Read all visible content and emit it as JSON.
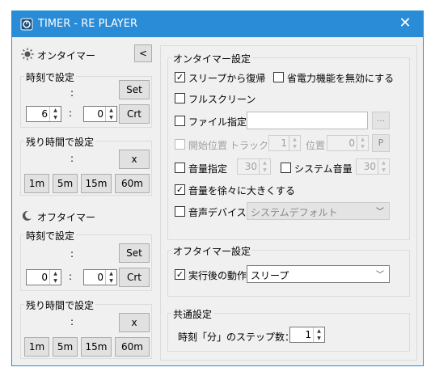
{
  "window": {
    "title": "TIMER - RE PLAYER"
  },
  "left": {
    "on_timer": {
      "label": "オンタイマー",
      "collapse_label": "<",
      "time_group": {
        "title": "時刻で設定",
        "dot": ":",
        "set_label": "Set",
        "hour": "6",
        "colon": ":",
        "minute": "0",
        "crt_label": "Crt"
      },
      "remain_group": {
        "title": "残り時間で設定",
        "dot": ":",
        "x_label": "x",
        "presets": [
          "1m",
          "5m",
          "15m",
          "60m"
        ]
      }
    },
    "off_timer": {
      "label": "オフタイマー",
      "time_group": {
        "title": "時刻で設定",
        "dot": ":",
        "set_label": "Set",
        "hour": "0",
        "colon": ":",
        "minute": "0",
        "crt_label": "Crt"
      },
      "remain_group": {
        "title": "残り時間で設定",
        "dot": ":",
        "x_label": "x",
        "presets": [
          "1m",
          "5m",
          "15m",
          "60m"
        ]
      }
    }
  },
  "right": {
    "on_settings": {
      "title": "オンタイマー設定",
      "resume_from_sleep": {
        "label": "スリープから復帰",
        "checked": true
      },
      "disable_power_saving": {
        "label": "省電力機能を無効にする",
        "checked": false
      },
      "fullscreen": {
        "label": "フルスクリーン",
        "checked": false
      },
      "file_specify": {
        "label": "ファイル指定",
        "checked": false,
        "browse": "…"
      },
      "start_position": {
        "label": "開始位置",
        "track_label": "トラック",
        "track": "1",
        "pos_label": "位置",
        "pos": "0",
        "p_label": "P"
      },
      "volume_specify": {
        "label": "音量指定",
        "value": "30",
        "checked": false
      },
      "system_volume": {
        "label": "システム音量",
        "value": "30",
        "checked": false
      },
      "gradual_volume": {
        "label": "音量を徐々に大きくする",
        "checked": true
      },
      "audio_device": {
        "label": "音声デバイス",
        "value": "システムデフォルト",
        "checked": false
      }
    },
    "off_settings": {
      "title": "オフタイマー設定",
      "action_after": {
        "label": "実行後の動作",
        "checked": true,
        "value": "スリープ"
      }
    },
    "common": {
      "title": "共通設定",
      "step_label": "時刻「分」のステップ数：",
      "step_value": "1"
    }
  }
}
